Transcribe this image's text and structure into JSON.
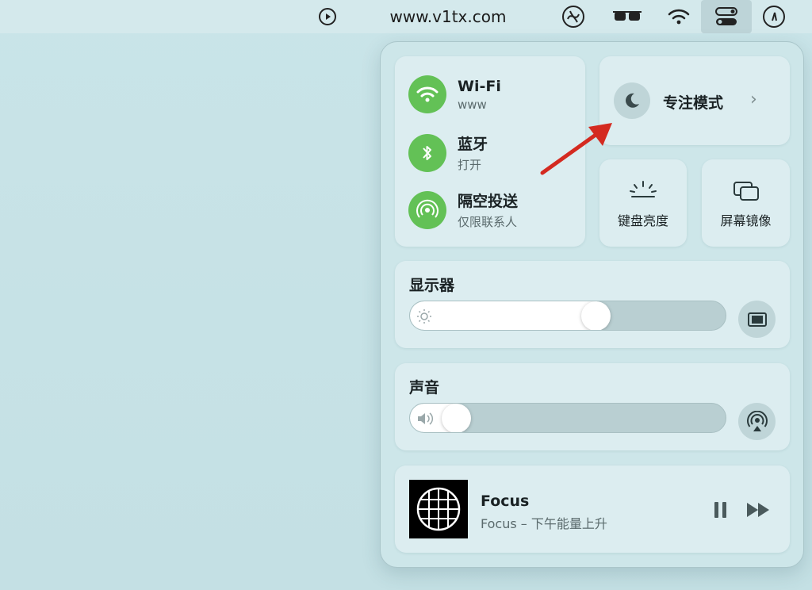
{
  "menubar": {
    "url_text": "www.v1tx.com",
    "icons": [
      "play-circle-icon",
      "logo-icon",
      "glasses-icon",
      "wifi-icon",
      "control-center-icon",
      "gauge-icon"
    ]
  },
  "network": {
    "wifi": {
      "title": "Wi-Fi",
      "subtitle": "www"
    },
    "bluetooth": {
      "title": "蓝牙",
      "subtitle": "打开"
    },
    "airdrop": {
      "title": "隔空投送",
      "subtitle": "仅限联系人"
    }
  },
  "focus": {
    "label": "专注模式",
    "chevron": "›"
  },
  "keyboard_brightness": {
    "label": "键盘亮度"
  },
  "screen_mirroring": {
    "label": "屏幕镜像"
  },
  "display": {
    "title": "显示器",
    "level": 0.595
  },
  "sound": {
    "title": "声音",
    "level": 0.11
  },
  "now_playing": {
    "title": "Focus",
    "subtitle": "Focus – 下午能量上升"
  },
  "colors": {
    "accent_green": "#63c156",
    "annotation_red": "#d42a20"
  }
}
